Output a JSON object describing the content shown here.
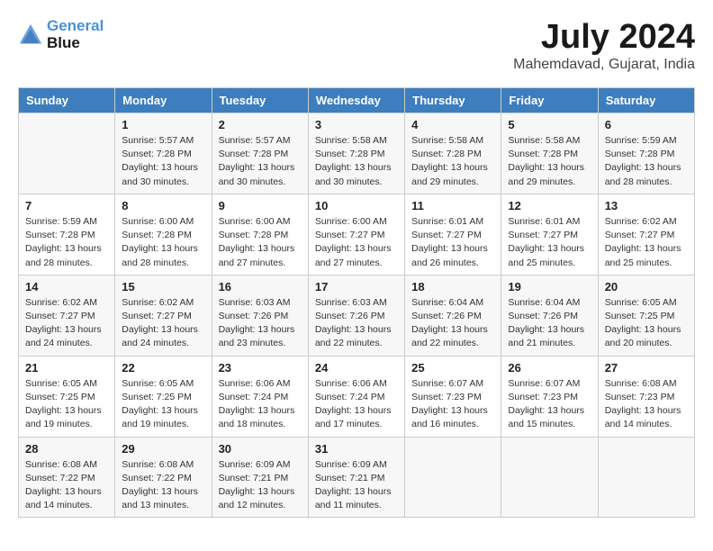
{
  "header": {
    "logo_line1": "General",
    "logo_line2": "Blue",
    "month_year": "July 2024",
    "location": "Mahemdavad, Gujarat, India"
  },
  "weekdays": [
    "Sunday",
    "Monday",
    "Tuesday",
    "Wednesday",
    "Thursday",
    "Friday",
    "Saturday"
  ],
  "weeks": [
    [
      {
        "day": "",
        "info": ""
      },
      {
        "day": "1",
        "info": "Sunrise: 5:57 AM\nSunset: 7:28 PM\nDaylight: 13 hours\nand 30 minutes."
      },
      {
        "day": "2",
        "info": "Sunrise: 5:57 AM\nSunset: 7:28 PM\nDaylight: 13 hours\nand 30 minutes."
      },
      {
        "day": "3",
        "info": "Sunrise: 5:58 AM\nSunset: 7:28 PM\nDaylight: 13 hours\nand 30 minutes."
      },
      {
        "day": "4",
        "info": "Sunrise: 5:58 AM\nSunset: 7:28 PM\nDaylight: 13 hours\nand 29 minutes."
      },
      {
        "day": "5",
        "info": "Sunrise: 5:58 AM\nSunset: 7:28 PM\nDaylight: 13 hours\nand 29 minutes."
      },
      {
        "day": "6",
        "info": "Sunrise: 5:59 AM\nSunset: 7:28 PM\nDaylight: 13 hours\nand 28 minutes."
      }
    ],
    [
      {
        "day": "7",
        "info": "Sunrise: 5:59 AM\nSunset: 7:28 PM\nDaylight: 13 hours\nand 28 minutes."
      },
      {
        "day": "8",
        "info": "Sunrise: 6:00 AM\nSunset: 7:28 PM\nDaylight: 13 hours\nand 28 minutes."
      },
      {
        "day": "9",
        "info": "Sunrise: 6:00 AM\nSunset: 7:28 PM\nDaylight: 13 hours\nand 27 minutes."
      },
      {
        "day": "10",
        "info": "Sunrise: 6:00 AM\nSunset: 7:27 PM\nDaylight: 13 hours\nand 27 minutes."
      },
      {
        "day": "11",
        "info": "Sunrise: 6:01 AM\nSunset: 7:27 PM\nDaylight: 13 hours\nand 26 minutes."
      },
      {
        "day": "12",
        "info": "Sunrise: 6:01 AM\nSunset: 7:27 PM\nDaylight: 13 hours\nand 25 minutes."
      },
      {
        "day": "13",
        "info": "Sunrise: 6:02 AM\nSunset: 7:27 PM\nDaylight: 13 hours\nand 25 minutes."
      }
    ],
    [
      {
        "day": "14",
        "info": "Sunrise: 6:02 AM\nSunset: 7:27 PM\nDaylight: 13 hours\nand 24 minutes."
      },
      {
        "day": "15",
        "info": "Sunrise: 6:02 AM\nSunset: 7:27 PM\nDaylight: 13 hours\nand 24 minutes."
      },
      {
        "day": "16",
        "info": "Sunrise: 6:03 AM\nSunset: 7:26 PM\nDaylight: 13 hours\nand 23 minutes."
      },
      {
        "day": "17",
        "info": "Sunrise: 6:03 AM\nSunset: 7:26 PM\nDaylight: 13 hours\nand 22 minutes."
      },
      {
        "day": "18",
        "info": "Sunrise: 6:04 AM\nSunset: 7:26 PM\nDaylight: 13 hours\nand 22 minutes."
      },
      {
        "day": "19",
        "info": "Sunrise: 6:04 AM\nSunset: 7:26 PM\nDaylight: 13 hours\nand 21 minutes."
      },
      {
        "day": "20",
        "info": "Sunrise: 6:05 AM\nSunset: 7:25 PM\nDaylight: 13 hours\nand 20 minutes."
      }
    ],
    [
      {
        "day": "21",
        "info": "Sunrise: 6:05 AM\nSunset: 7:25 PM\nDaylight: 13 hours\nand 19 minutes."
      },
      {
        "day": "22",
        "info": "Sunrise: 6:05 AM\nSunset: 7:25 PM\nDaylight: 13 hours\nand 19 minutes."
      },
      {
        "day": "23",
        "info": "Sunrise: 6:06 AM\nSunset: 7:24 PM\nDaylight: 13 hours\nand 18 minutes."
      },
      {
        "day": "24",
        "info": "Sunrise: 6:06 AM\nSunset: 7:24 PM\nDaylight: 13 hours\nand 17 minutes."
      },
      {
        "day": "25",
        "info": "Sunrise: 6:07 AM\nSunset: 7:23 PM\nDaylight: 13 hours\nand 16 minutes."
      },
      {
        "day": "26",
        "info": "Sunrise: 6:07 AM\nSunset: 7:23 PM\nDaylight: 13 hours\nand 15 minutes."
      },
      {
        "day": "27",
        "info": "Sunrise: 6:08 AM\nSunset: 7:23 PM\nDaylight: 13 hours\nand 14 minutes."
      }
    ],
    [
      {
        "day": "28",
        "info": "Sunrise: 6:08 AM\nSunset: 7:22 PM\nDaylight: 13 hours\nand 14 minutes."
      },
      {
        "day": "29",
        "info": "Sunrise: 6:08 AM\nSunset: 7:22 PM\nDaylight: 13 hours\nand 13 minutes."
      },
      {
        "day": "30",
        "info": "Sunrise: 6:09 AM\nSunset: 7:21 PM\nDaylight: 13 hours\nand 12 minutes."
      },
      {
        "day": "31",
        "info": "Sunrise: 6:09 AM\nSunset: 7:21 PM\nDaylight: 13 hours\nand 11 minutes."
      },
      {
        "day": "",
        "info": ""
      },
      {
        "day": "",
        "info": ""
      },
      {
        "day": "",
        "info": ""
      }
    ]
  ]
}
